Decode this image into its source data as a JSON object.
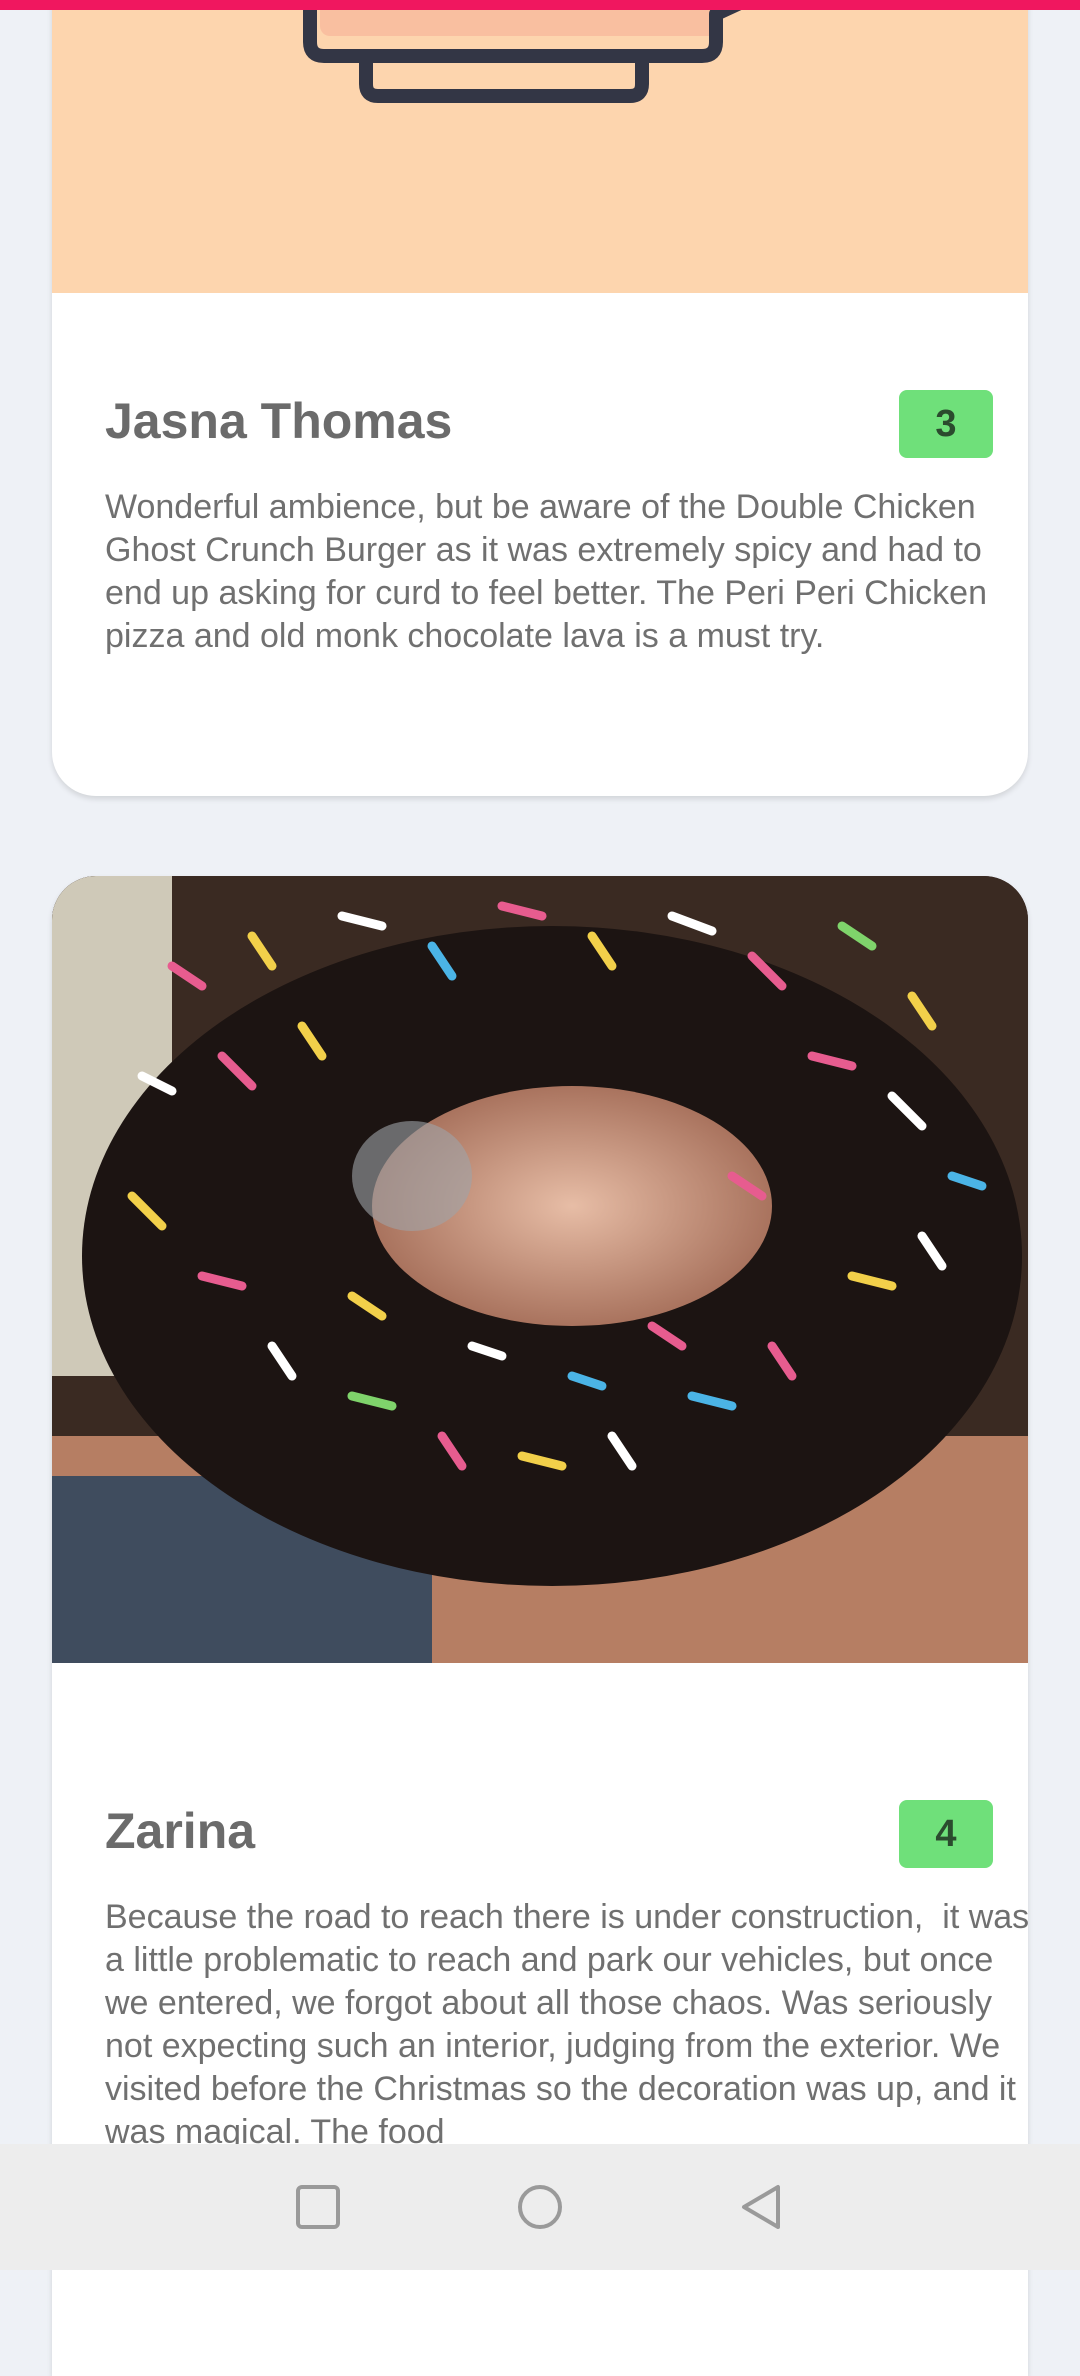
{
  "reviews": [
    {
      "name": "Jasna Thomas",
      "rating": "3",
      "text": "Wonderful ambience, but be aware of the Double Chicken Ghost Crunch Burger as it was extremely spicy and had to end up asking for curd to feel better. The Peri Peri Chicken pizza and old monk chocolate lava is a must try.",
      "image_icon": "restaurant-illustration"
    },
    {
      "name": "Zarina",
      "rating": "4",
      "text": "Because the road to reach there is under construction,  it was a little problematic to reach and park our vehicles, but once we entered, we forgot about all those chaos. Was seriously not expecting such an interior, judging from the exterior. We visited before the Christmas so the decoration was up, and it was magical. The food",
      "image_icon": "donut-photo"
    }
  ],
  "nav": {
    "buttons": [
      "recents-icon",
      "home-icon",
      "back-icon"
    ]
  },
  "colors": {
    "accent": "#F0175F",
    "badge": "#6FE07A",
    "background": "#EEF1F6"
  }
}
